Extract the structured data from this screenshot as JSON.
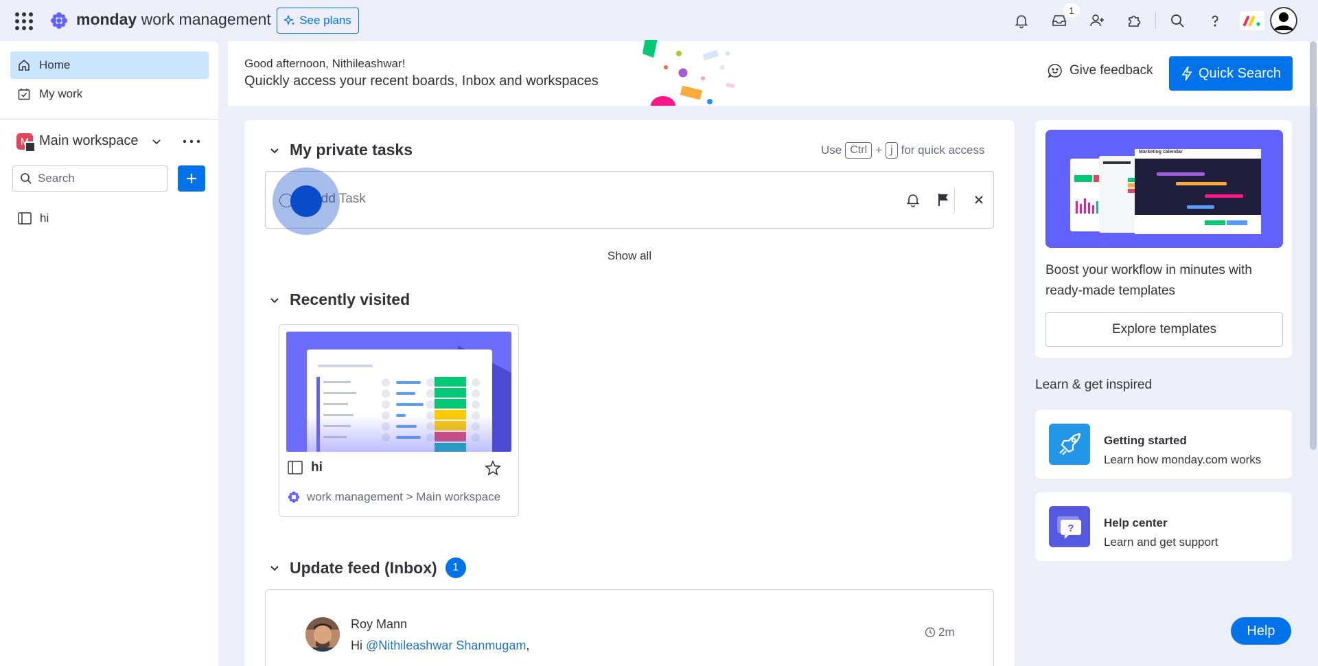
{
  "topbar": {
    "brand_bold": "monday",
    "brand_rest": " work management",
    "see_plans": "See plans",
    "inbox_count": "1"
  },
  "sidebar": {
    "items": [
      {
        "label": "Home",
        "icon": "home-icon",
        "active": true
      },
      {
        "label": "My work",
        "icon": "calendar-check-icon",
        "active": false
      }
    ],
    "workspace": {
      "initial": "M",
      "name": "Main workspace",
      "badge_color": "#e2445c"
    },
    "search_placeholder": "Search",
    "boards": [
      {
        "label": "hi",
        "icon": "board-icon"
      }
    ]
  },
  "header": {
    "greeting": "Good afternoon, Nithileashwar!",
    "subtitle": "Quickly access your recent boards, Inbox and workspaces",
    "feedback": "Give feedback",
    "quick_search": "Quick Search"
  },
  "private_tasks": {
    "title": "My private tasks",
    "shortcut_use": "Use",
    "shortcut_key1": "Ctrl",
    "shortcut_plus": "+",
    "shortcut_key2": "j",
    "shortcut_suffix": "for quick access",
    "add_placeholder": "Add Task",
    "show_all": "Show all"
  },
  "recently_visited": {
    "title": "Recently visited",
    "board_name": "hi",
    "path": "work management > Main workspace"
  },
  "update_feed": {
    "title": "Update feed (Inbox)",
    "count": "1",
    "author": "Roy Mann",
    "text_prefix": "Hi ",
    "mention": "@Nithileashwar Shanmugam",
    "text_suffix": ",",
    "time": "2m"
  },
  "templates": {
    "promo_text": "Boost your workflow in minutes with ready-made templates",
    "explore": "Explore templates",
    "thumb_title": "Marketing calendar"
  },
  "learn": {
    "title": "Learn & get inspired",
    "cards": [
      {
        "heading": "Getting started",
        "sub": "Learn how monday.com works",
        "icon": "rocket-icon"
      },
      {
        "heading": "Help center",
        "sub": "Learn and get support",
        "icon": "help-chat-icon"
      }
    ]
  },
  "help_button": "Help",
  "colors": {
    "accent": "#0073ea",
    "active_nav": "#cce5ff",
    "app_bg": "#eceff8"
  }
}
